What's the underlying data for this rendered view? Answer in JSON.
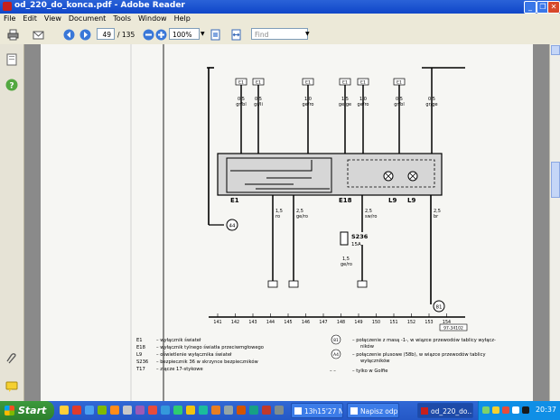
{
  "window": {
    "title": "od_220_do_konca.pdf - Adobe Reader"
  },
  "menu": [
    "File",
    "Edit",
    "View",
    "Document",
    "Tools",
    "Window",
    "Help"
  ],
  "toolbar": {
    "page_current": "49",
    "page_total": "/ 135",
    "zoom": "100%",
    "find_placeholder": "Find"
  },
  "diagram": {
    "fuse_labels": [
      "E1",
      "E1",
      "E1",
      "E1",
      "E1",
      "E1"
    ],
    "wire_top": [
      {
        "size": "0,5",
        "color": "gr/bl"
      },
      {
        "size": "0,5",
        "color": "gr/li"
      },
      {
        "size": "1,0",
        "color": "ge/ro"
      },
      {
        "size": "1,5",
        "color": "ge/ge"
      },
      {
        "size": "1,0",
        "color": "ge/ro"
      },
      {
        "size": "0,5",
        "color": "gr/bl"
      },
      {
        "size": "0,5",
        "color": "gr/ge"
      }
    ],
    "components": {
      "e1": "E1",
      "e18": "E18",
      "l9": "L9",
      "l9b": "L9",
      "s236": "S236",
      "s236_rating": "15A",
      "marker_44": "44",
      "marker_81": "81"
    },
    "wire_bottom": [
      {
        "size": "1,5",
        "color": "ro"
      },
      {
        "size": "2,5",
        "color": "ge/ro"
      },
      {
        "size": "2,5",
        "color": "sw/ro"
      },
      {
        "size": "2,5",
        "color": "br"
      }
    ],
    "fuse_wire": {
      "size": "1,5",
      "color": "ge/ro"
    },
    "ruler": [
      "141",
      "142",
      "143",
      "144",
      "145",
      "146",
      "147",
      "148",
      "149",
      "150",
      "151",
      "152",
      "153",
      "154"
    ],
    "ref_id": "97-34102"
  },
  "legend": {
    "left": [
      {
        "code": "E1",
        "text": "– wyłącznik świateł"
      },
      {
        "code": "E18",
        "text": "– wyłącznik tylnego światła przeciwmgłowego"
      },
      {
        "code": "L9",
        "text": "– oświetlenie wyłącznika świateł"
      },
      {
        "code": "S236",
        "text": "– bezpiecznik 36 w skrzynce bezpieczników"
      },
      {
        "code": "T17",
        "text": "– złącze 17-stykowe"
      }
    ],
    "right": [
      {
        "code": "81",
        "text": "– połączenie z masą -1-, w wiązce przewodów tablicy wyłącz-",
        "cont": "ników"
      },
      {
        "code": "A4",
        "text": "– połączenie plusowe (58b), w wiązce przewodów tablicy",
        "cont": "wyłączników"
      },
      {
        "code": "– –",
        "text": "– tylko w Golfie",
        "cont": ""
      }
    ]
  },
  "taskbar": {
    "start": "Start",
    "items": [
      "13h15'27 N...",
      "Napisz odp...",
      "od_220_do..."
    ],
    "clock": "20:37"
  },
  "colors": {
    "titlebar": "#0f46c8",
    "taskbar": "#2458c6",
    "start": "#2d7f2d",
    "doc_bg": "#8a8a8a"
  }
}
